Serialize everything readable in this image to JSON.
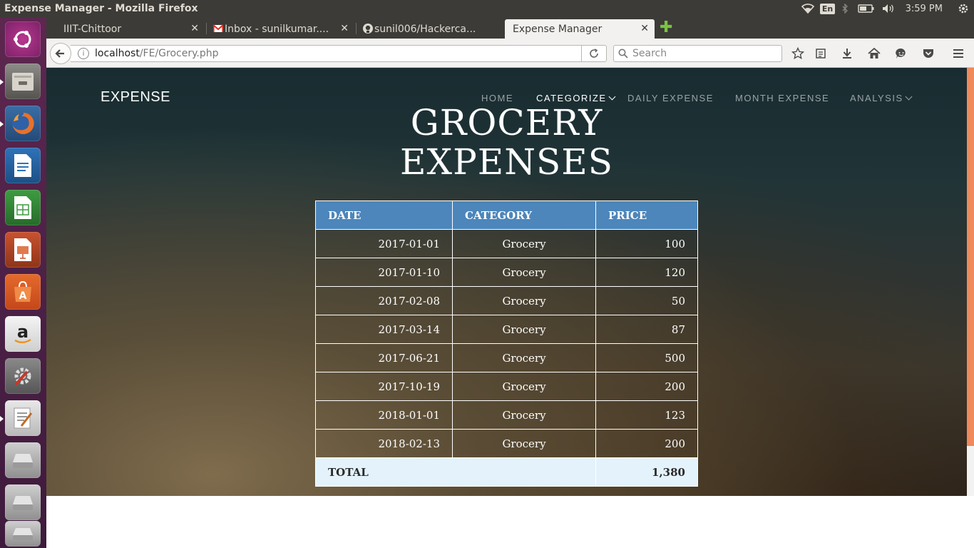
{
  "os": {
    "window_title": "Expense Manager - Mozilla Firefox",
    "keyboard_layout": "En",
    "clock": "3:59 PM"
  },
  "browser": {
    "tabs": [
      {
        "label": "IIIT-Chittoor",
        "active": false
      },
      {
        "label": "Inbox - sunilkumar....",
        "active": false
      },
      {
        "label": "sunil006/Hackerca...",
        "active": false
      },
      {
        "label": "Expense Manager",
        "active": true
      }
    ],
    "url_host": "localhost",
    "url_path": "/FE/Grocery.php",
    "search_placeholder": "Search"
  },
  "site": {
    "brand": "EXPENSE",
    "nav": {
      "home": "HOME",
      "categorize": "CATEGORIZE",
      "daily": "DAILY EXPENSE",
      "month": "MONTH EXPENSE",
      "analysis": "ANALYSIS"
    },
    "title_line1": "GROCERY",
    "title_line2": "EXPENSES"
  },
  "table": {
    "headers": {
      "date": "DATE",
      "category": "CATEGORY",
      "price": "PRICE"
    },
    "rows": [
      {
        "date": "2017-01-01",
        "category": "Grocery",
        "price": "100"
      },
      {
        "date": "2017-01-10",
        "category": "Grocery",
        "price": "120"
      },
      {
        "date": "2017-02-08",
        "category": "Grocery",
        "price": "50"
      },
      {
        "date": "2017-03-14",
        "category": "Grocery",
        "price": "87"
      },
      {
        "date": "2017-06-21",
        "category": "Grocery",
        "price": "500"
      },
      {
        "date": "2017-10-19",
        "category": "Grocery",
        "price": "200"
      },
      {
        "date": "2018-01-01",
        "category": "Grocery",
        "price": "123"
      },
      {
        "date": "2018-02-13",
        "category": "Grocery",
        "price": "200"
      }
    ],
    "total_label": "TOTAL",
    "total_value": "1,380"
  },
  "colors": {
    "header_blue": "#4c86bb",
    "total_bg": "#e4f2fc",
    "scroll_thumb": "#ee8a5b"
  }
}
